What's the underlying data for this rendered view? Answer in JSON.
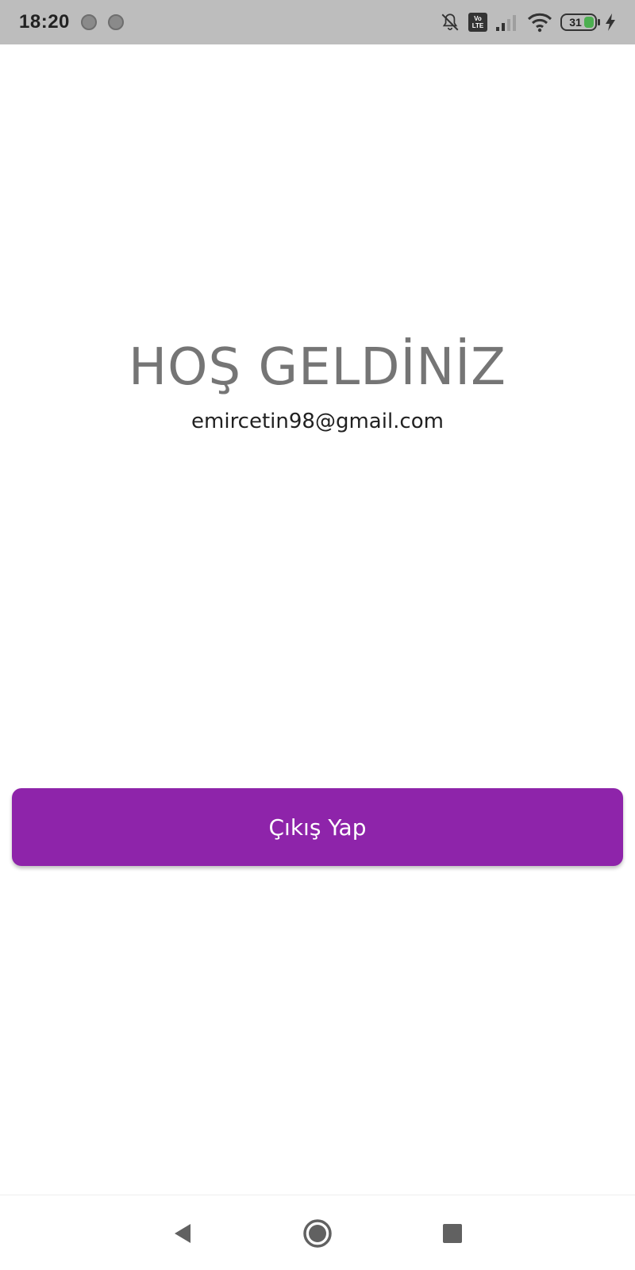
{
  "status_bar": {
    "time": "18:20",
    "notification_dot_count": 2,
    "battery_level": "31",
    "icons": [
      "notifications-off-icon",
      "volte-icon",
      "signal-icon",
      "wifi-icon",
      "battery-icon",
      "charging-icon"
    ],
    "volte_top": "Vo",
    "volte_bottom": "LTE"
  },
  "main": {
    "title": "HOŞ GELDİNİZ",
    "email": "emircetin98@gmail.com",
    "logout_label": "Çıkış Yap"
  },
  "nav_bar": {
    "icons": [
      "back-icon",
      "home-icon",
      "recents-icon"
    ]
  },
  "colors": {
    "status_bar_bg": "#bdbdbd",
    "title_text": "#757575",
    "email_text": "#212121",
    "button_bg": "#8e24aa",
    "button_text": "#ffffff",
    "battery_fill": "#4caf50"
  }
}
